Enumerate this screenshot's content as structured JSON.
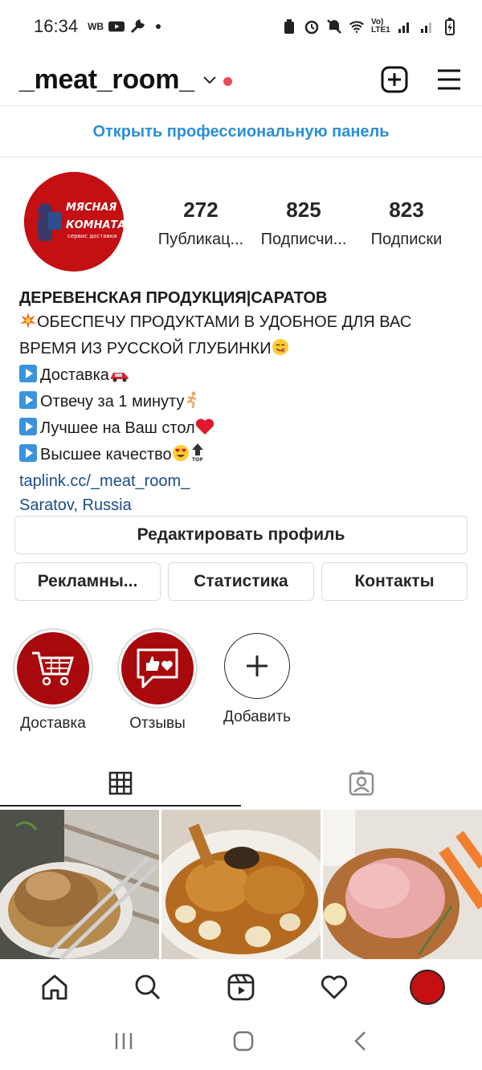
{
  "status_bar": {
    "time": "16:34",
    "carrier_badge": "WB",
    "network_label": "Vo) LTE1"
  },
  "header": {
    "username": "_meat_room_"
  },
  "pro_panel": {
    "label": "Открыть профессиональную панель"
  },
  "profile": {
    "avatar_text": "МЯСНАЯ КОМНАТА",
    "avatar_subtext": "сервис доставки",
    "stats": [
      {
        "value": "272",
        "label": "Публикац..."
      },
      {
        "value": "825",
        "label": "Подписчи..."
      },
      {
        "value": "823",
        "label": "Подписки"
      }
    ],
    "bio": {
      "name": "ДЕРЕВЕНСКАЯ ПРОДУКЦИЯ|САРАТОВ",
      "line1": "ОБЕСПЕЧУ ПРОДУКТАМИ В УДОБНОЕ ДЛЯ ВАС ВРЕМЯ ИЗ РУССКОЙ ГЛУБИНКИ",
      "items": [
        "Доставка",
        "Отвечу за 1 минуту",
        "Лучшее на Ваш стол",
        "Высшее качество"
      ],
      "link": "taplink.cc/_meat_room_",
      "location": "Saratov, Russia"
    }
  },
  "buttons": {
    "edit_profile": "Редактировать профиль",
    "ads": "Рекламны...",
    "stats": "Статистика",
    "contacts": "Контакты"
  },
  "highlights": [
    {
      "label": "Доставка",
      "icon": "cart-icon"
    },
    {
      "label": "Отзывы",
      "icon": "review-icon"
    },
    {
      "label": "Добавить",
      "icon": "plus-icon"
    }
  ],
  "tabs": [
    {
      "name": "grid",
      "icon": "grid-icon",
      "active": true
    },
    {
      "name": "tagged",
      "icon": "tagged-icon",
      "active": false
    }
  ],
  "colors": {
    "accent_blue": "#2a8fd6",
    "brand_red": "#c40f13",
    "notification_red": "#ed4956"
  }
}
